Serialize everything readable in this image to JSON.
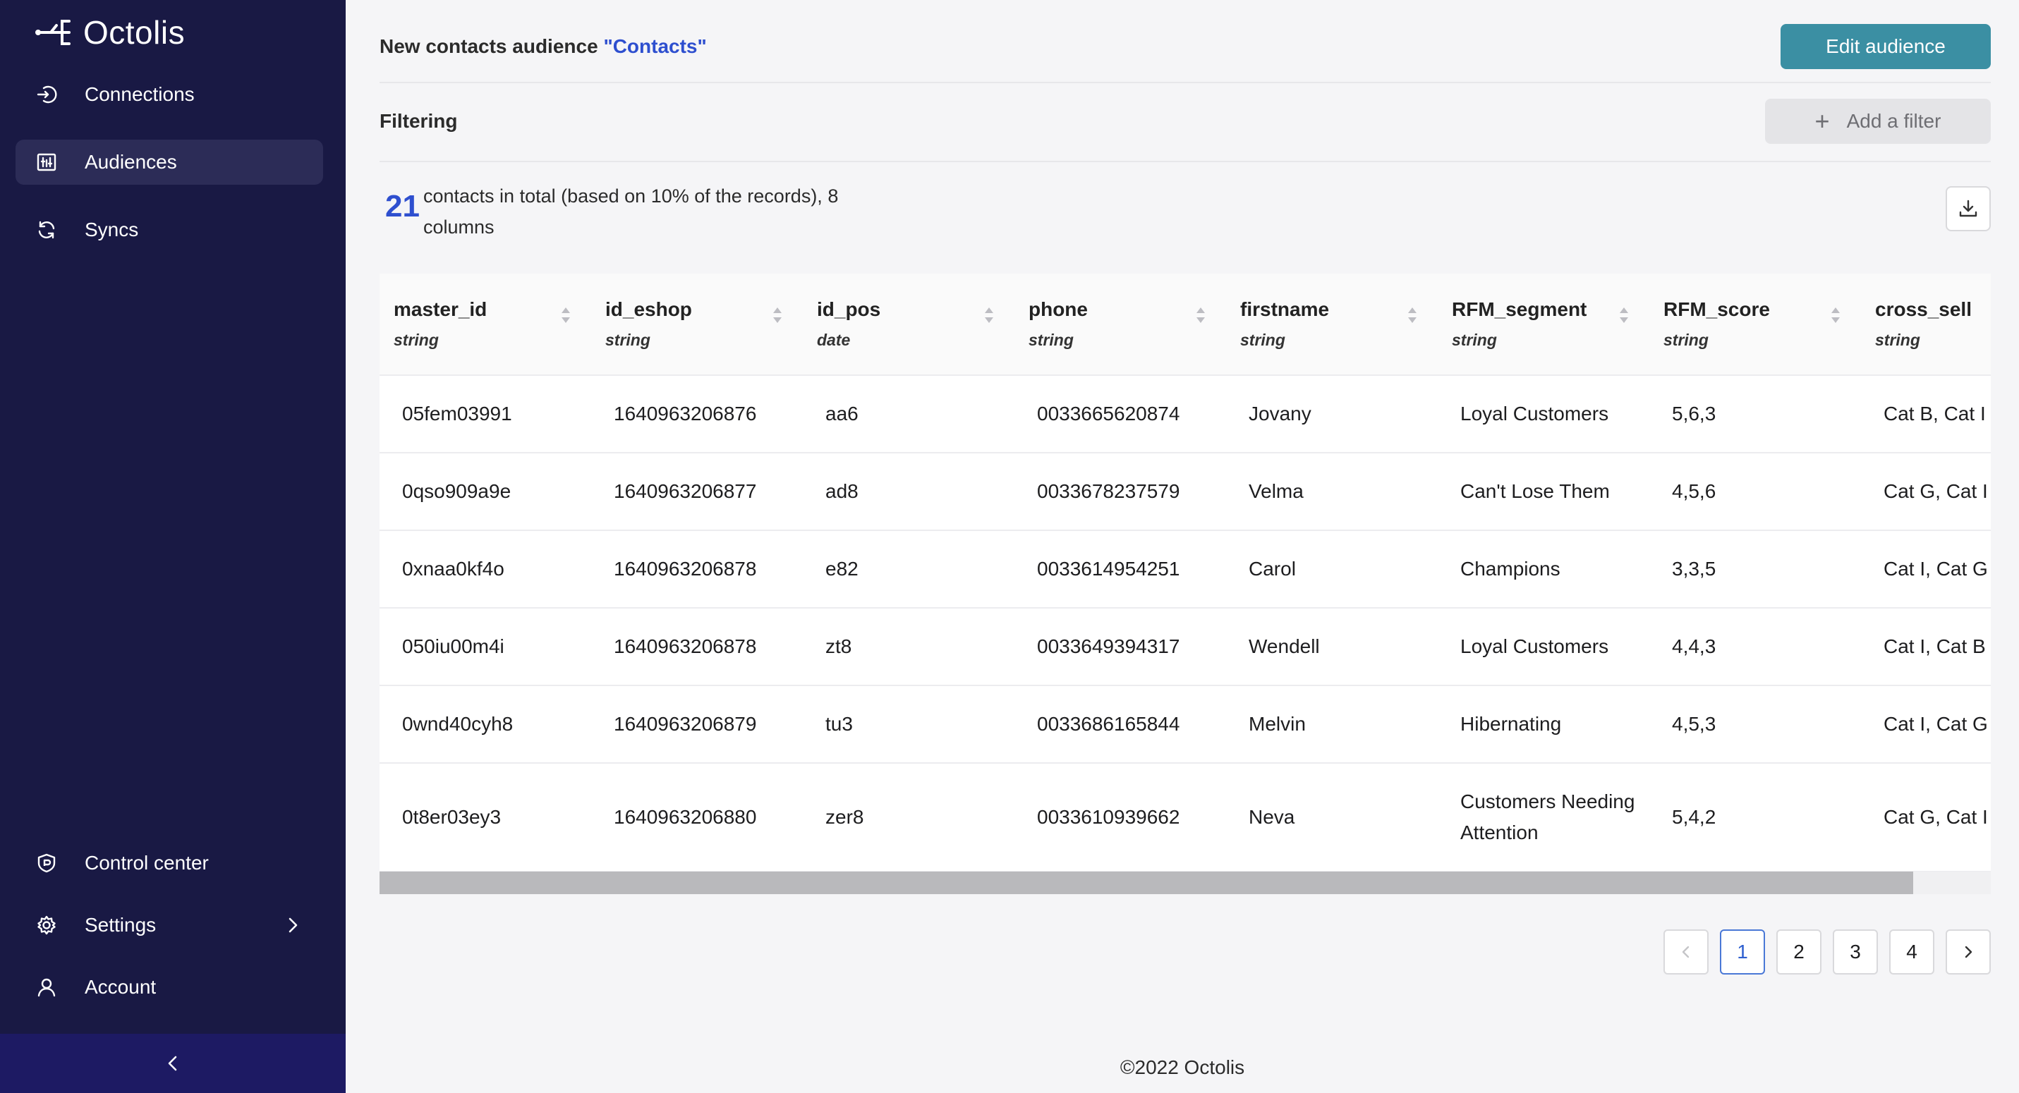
{
  "app": {
    "name": "Octolis"
  },
  "sidebar": {
    "items": [
      {
        "label": "Connections",
        "icon": "connections-icon"
      },
      {
        "label": "Audiences",
        "icon": "audiences-icon",
        "active": true
      },
      {
        "label": "Syncs",
        "icon": "syncs-icon"
      }
    ],
    "bottom_items": [
      {
        "label": "Control center",
        "icon": "shield-icon"
      },
      {
        "label": "Settings",
        "icon": "gear-icon"
      },
      {
        "label": "Account",
        "icon": "user-icon"
      }
    ],
    "collapse_icon": "chevron-left-icon"
  },
  "header": {
    "title_prefix": "New contacts audience",
    "title_name": "\"Contacts\"",
    "edit_button": "Edit audience"
  },
  "filtering": {
    "label": "Filtering",
    "add_filter_button": "Add a filter"
  },
  "summary": {
    "count": "21",
    "text": "contacts in total (based on 10% of the records), 8 columns"
  },
  "table": {
    "columns": [
      {
        "name": "master_id",
        "type": "string"
      },
      {
        "name": "id_eshop",
        "type": "string"
      },
      {
        "name": "id_pos",
        "type": "date"
      },
      {
        "name": "phone",
        "type": "string"
      },
      {
        "name": "firstname",
        "type": "string"
      },
      {
        "name": "RFM_segment",
        "type": "string"
      },
      {
        "name": "RFM_score",
        "type": "string"
      },
      {
        "name": "cross_sell",
        "type": "string"
      }
    ],
    "rows": [
      [
        "05fem03991",
        "1640963206876",
        "aa6",
        "0033665620874",
        "Jovany",
        "Loyal Customers",
        "5,6,3",
        "Cat B, Cat I"
      ],
      [
        "0qso909a9e",
        "1640963206877",
        "ad8",
        "0033678237579",
        "Velma",
        "Can't Lose Them",
        "4,5,6",
        "Cat G, Cat I"
      ],
      [
        "0xnaa0kf4o",
        "1640963206878",
        "e82",
        "0033614954251",
        "Carol",
        "Champions",
        "3,3,5",
        "Cat I, Cat G"
      ],
      [
        "050iu00m4i",
        "1640963206878",
        "zt8",
        "0033649394317",
        "Wendell",
        "Loyal Customers",
        "4,4,3",
        "Cat I, Cat B"
      ],
      [
        "0wnd40cyh8",
        "1640963206879",
        "tu3",
        "0033686165844",
        "Melvin",
        "Hibernating",
        "4,5,3",
        "Cat I, Cat G"
      ],
      [
        "0t8er03ey3",
        "1640963206880",
        "zer8",
        "0033610939662",
        "Neva",
        "Customers Needing Attention",
        "5,4,2",
        "Cat G, Cat I"
      ]
    ]
  },
  "pagination": {
    "prev_icon": "chevron-left-icon",
    "pages": [
      "1",
      "2",
      "3",
      "4"
    ],
    "current": "1",
    "next_icon": "chevron-right-icon"
  },
  "footer": {
    "text": "©2022 Octolis"
  },
  "colors": {
    "sidebar_bg": "#191944",
    "accent_blue": "#2e4fcf",
    "edit_button_bg": "#3b8fa3"
  }
}
